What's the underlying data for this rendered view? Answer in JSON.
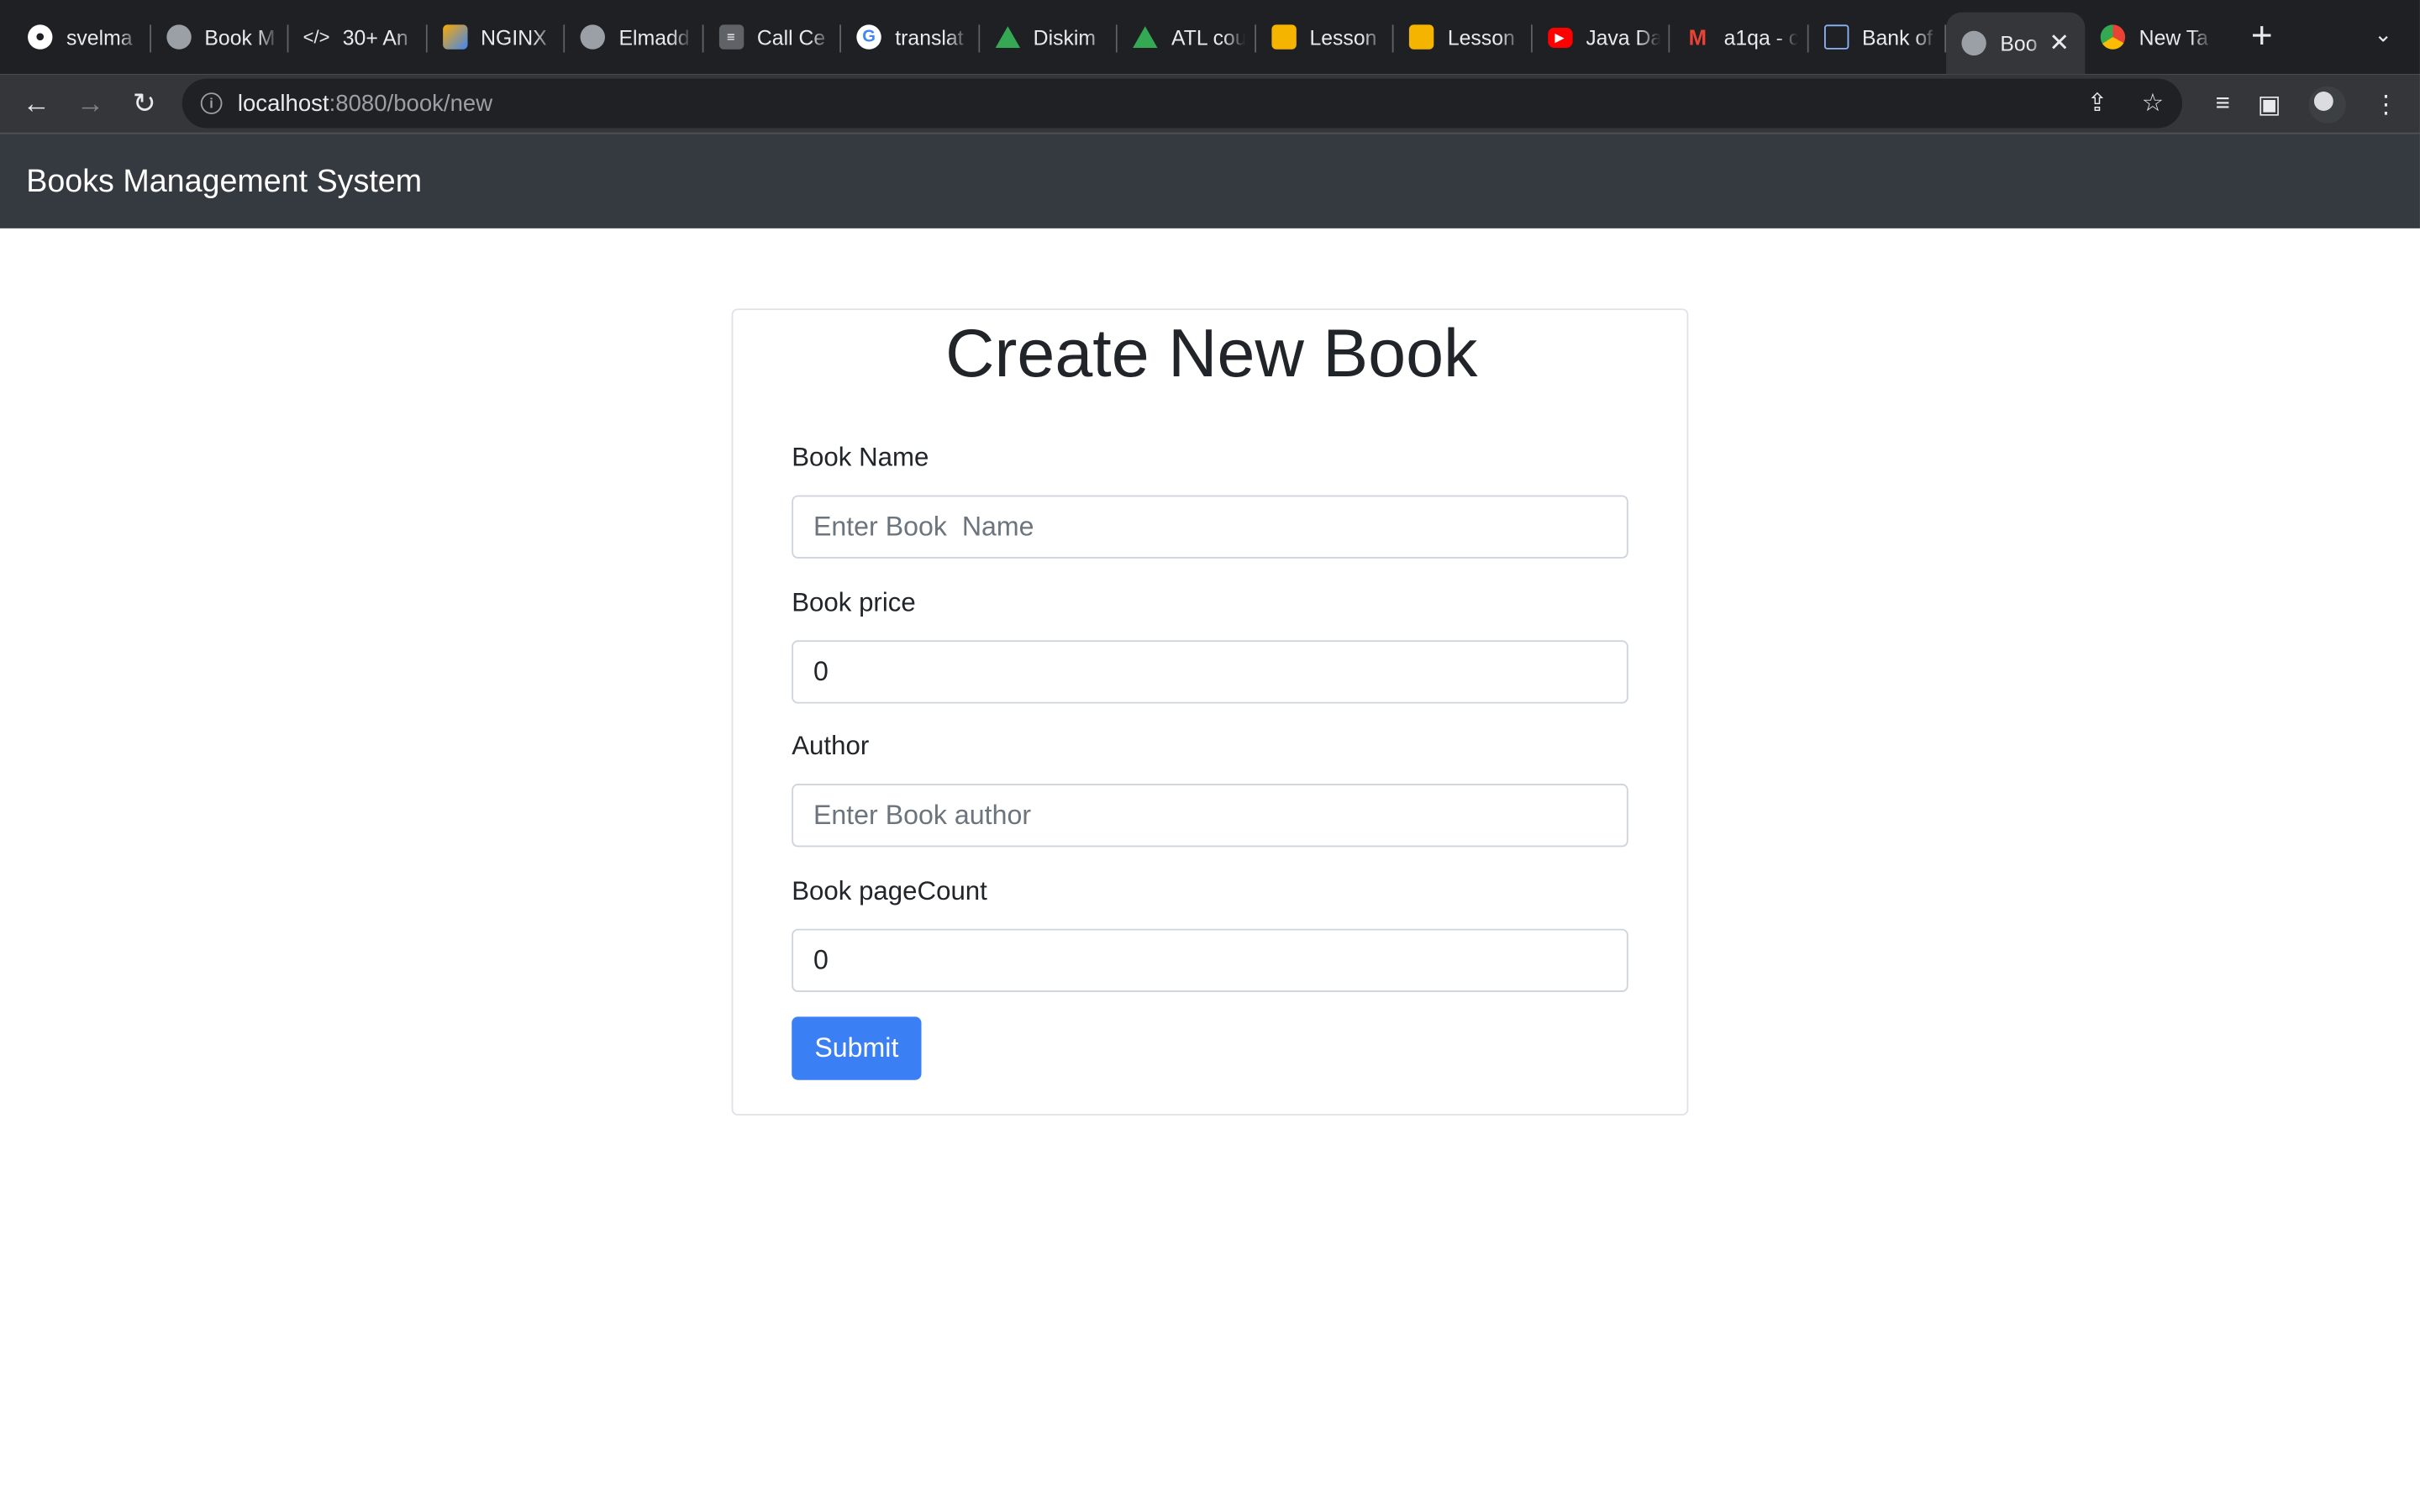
{
  "browser": {
    "tabs": [
      {
        "label": "svelma",
        "icon": "github-icon"
      },
      {
        "label": "Book M",
        "icon": "globe-icon"
      },
      {
        "label": "30+ An",
        "icon": "code-icon"
      },
      {
        "label": "NGINX",
        "icon": "nginx-icon"
      },
      {
        "label": "Elmadd",
        "icon": "globe-icon"
      },
      {
        "label": "Call Ce",
        "icon": "stack-icon"
      },
      {
        "label": "translat",
        "icon": "google-icon"
      },
      {
        "label": "Diskim",
        "icon": "drive-icon"
      },
      {
        "label": "ATL cou",
        "icon": "drive-icon"
      },
      {
        "label": "Lesson",
        "icon": "slides-icon"
      },
      {
        "label": "Lesson",
        "icon": "slides-icon"
      },
      {
        "label": "Java Da",
        "icon": "youtube-icon"
      },
      {
        "label": "a1qa - c",
        "icon": "gmail-icon"
      },
      {
        "label": "Bank of",
        "icon": "bank-icon"
      },
      {
        "label": "Boo",
        "icon": "globe-icon",
        "active": true
      },
      {
        "label": "New Ta",
        "icon": "chrome-icon"
      }
    ],
    "url_host": "localhost",
    "url_path": ":8080/book/new"
  },
  "app": {
    "brand": "Books Management System"
  },
  "form": {
    "title": "Create New Book",
    "fields": [
      {
        "label": "Book Name",
        "value": "",
        "placeholder": "Enter Book  Name"
      },
      {
        "label": "Book price",
        "value": "0",
        "placeholder": ""
      },
      {
        "label": "Author",
        "value": "",
        "placeholder": "Enter Book author"
      },
      {
        "label": "Book pageCount",
        "value": "0",
        "placeholder": ""
      }
    ],
    "submit_label": "Submit"
  },
  "colors": {
    "navbar_bg": "#343a40",
    "primary": "#3b7ff5",
    "browser_frame": "#1f2023"
  }
}
